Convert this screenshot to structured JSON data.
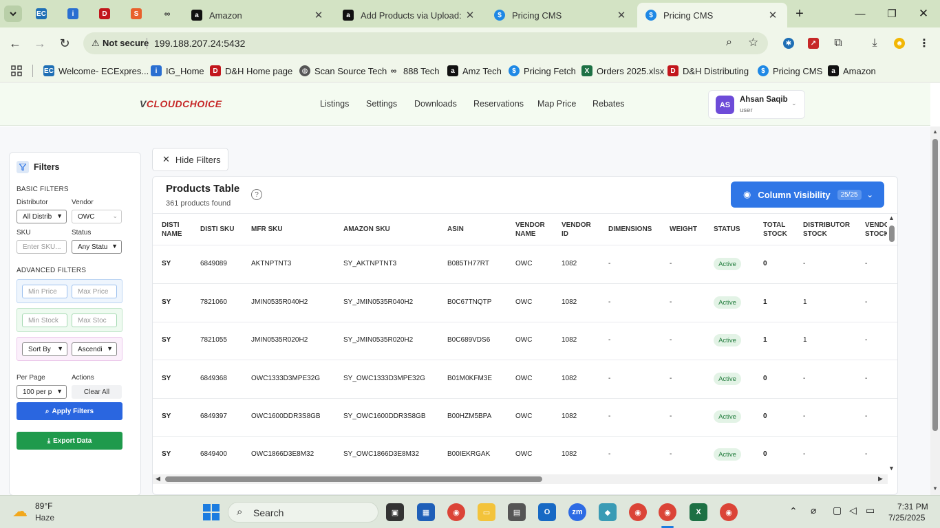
{
  "browser": {
    "tabs": [
      {
        "title": "Amazon",
        "fav": "a"
      },
      {
        "title": "Add Products via Upload: C",
        "fav": "a"
      },
      {
        "title": "Pricing CMS",
        "fav": "$"
      },
      {
        "title": "Pricing CMS",
        "fav": "$",
        "active": true
      }
    ],
    "pinned_icons": [
      "tab-search-icon",
      "ec-icon",
      "ig-icon",
      "dh-icon",
      "sync-icon",
      "888-icon"
    ],
    "address": {
      "security": "Not secure",
      "url": "199.188.207.24:5432"
    },
    "bookmarks": [
      "Welcome- ECExpres...",
      "IG_Home",
      "D&H Home page",
      "Scan Source Tech",
      "888 Tech",
      "Amz Tech",
      "Pricing Fetch",
      "Orders 2025.xlsx",
      "D&H Distributing",
      "Pricing CMS",
      "Amazon"
    ]
  },
  "app": {
    "logo": "CLOUDCHOICE",
    "nav": [
      "Listings",
      "Settings",
      "Downloads",
      "Reservations",
      "Map Price",
      "Rebates"
    ],
    "user": {
      "initials": "AS",
      "name": "Ahsan Saqib",
      "role": "user"
    }
  },
  "filters": {
    "title": "Filters",
    "basic_title": "BASIC FILTERS",
    "distributor_label": "Distributor",
    "distributor_value": "All Distrib",
    "vendor_label": "Vendor",
    "vendor_value": "OWC",
    "sku_label": "SKU",
    "sku_placeholder": "Enter SKU...",
    "status_label": "Status",
    "status_value": "Any Statu",
    "advanced_title": "ADVANCED FILTERS",
    "min_price": "Min Price",
    "max_price": "Max Price",
    "min_stock": "Min Stock",
    "max_stock": "Max Stoc",
    "sort_by": "Sort By",
    "order": "Ascendi",
    "per_page_label": "Per Page",
    "per_page_value": "100 per p",
    "actions_label": "Actions",
    "clear_all": "Clear All",
    "apply": "Apply Filters",
    "export": "Export Data"
  },
  "table": {
    "hide_filters": "Hide Filters",
    "title": "Products Table",
    "count": "361 products found",
    "column_visibility": "Column Visibility",
    "column_badge": "25/25",
    "headers": [
      [
        "DISTI",
        "NAME"
      ],
      [
        "DISTI SKU",
        ""
      ],
      [
        "MFR SKU",
        ""
      ],
      [
        "AMAZON SKU",
        ""
      ],
      [
        "ASIN",
        ""
      ],
      [
        "VENDOR",
        "NAME"
      ],
      [
        "VENDOR",
        "ID"
      ],
      [
        "DIMENSIONS",
        ""
      ],
      [
        "WEIGHT",
        ""
      ],
      [
        "STATUS",
        ""
      ],
      [
        "TOTAL",
        "STOCK"
      ],
      [
        "DISTRIBUTOR",
        "STOCK"
      ],
      [
        "VENDO",
        "STOCK"
      ]
    ],
    "rows": [
      [
        "SY",
        "6849089",
        "AKTNPTNT3",
        "SY_AKTNPTNT3",
        "B085TH77RT",
        "OWC",
        "1082",
        "-",
        "-",
        "Active",
        "0",
        "-",
        "-"
      ],
      [
        "SY",
        "7821060",
        "JMIN0535R040H2",
        "SY_JMIN0535R040H2",
        "B0C67TNQTP",
        "OWC",
        "1082",
        "-",
        "-",
        "Active",
        "1",
        "1",
        "-"
      ],
      [
        "SY",
        "7821055",
        "JMIN0535R020H2",
        "SY_JMIN0535R020H2",
        "B0C689VDS6",
        "OWC",
        "1082",
        "-",
        "-",
        "Active",
        "1",
        "1",
        "-"
      ],
      [
        "SY",
        "6849368",
        "OWC1333D3MPE32G",
        "SY_OWC1333D3MPE32G",
        "B01M0KFM3E",
        "OWC",
        "1082",
        "-",
        "-",
        "Active",
        "0",
        "-",
        "-"
      ],
      [
        "SY",
        "6849397",
        "OWC1600DDR3S8GB",
        "SY_OWC1600DDR3S8GB",
        "B00HZM5BPA",
        "OWC",
        "1082",
        "-",
        "-",
        "Active",
        "0",
        "-",
        "-"
      ],
      [
        "SY",
        "6849400",
        "OWC1866D3E8M32",
        "SY_OWC1866D3E8M32",
        "B00IEKRGAK",
        "OWC",
        "1082",
        "-",
        "-",
        "Active",
        "0",
        "-",
        "-"
      ]
    ]
  },
  "taskbar": {
    "weather_temp": "89°F",
    "weather_desc": "Haze",
    "search": "Search",
    "time": "7:31 PM",
    "date": "7/25/2025"
  }
}
